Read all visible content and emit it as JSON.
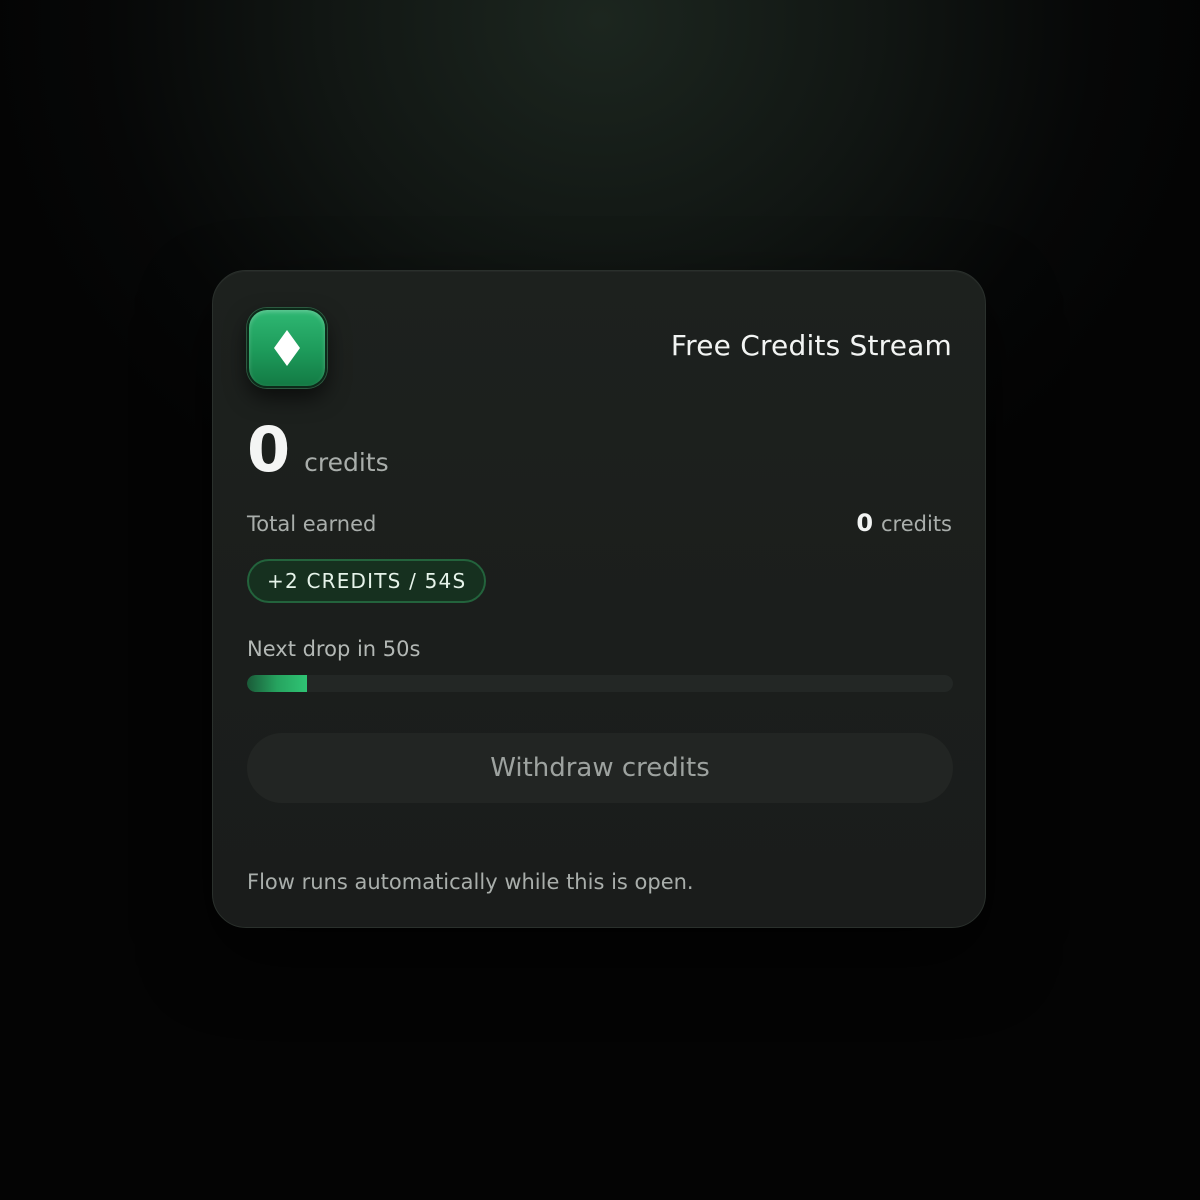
{
  "widget": {
    "title": "Free Credits Stream",
    "icon": "diamond-icon",
    "accent_color": "#2fb873"
  },
  "balance": {
    "value": "0",
    "unit": "credits"
  },
  "total_earned": {
    "label": "Total earned",
    "value": "0",
    "unit": "credits"
  },
  "rate_badge": {
    "text": "+2 CREDITS / 54S"
  },
  "next_drop": {
    "text": "Next drop in 50s",
    "progress_fraction": 0.085
  },
  "withdraw": {
    "label": "Withdraw credits"
  },
  "footer": {
    "note": "Flow runs automatically while this is open."
  }
}
